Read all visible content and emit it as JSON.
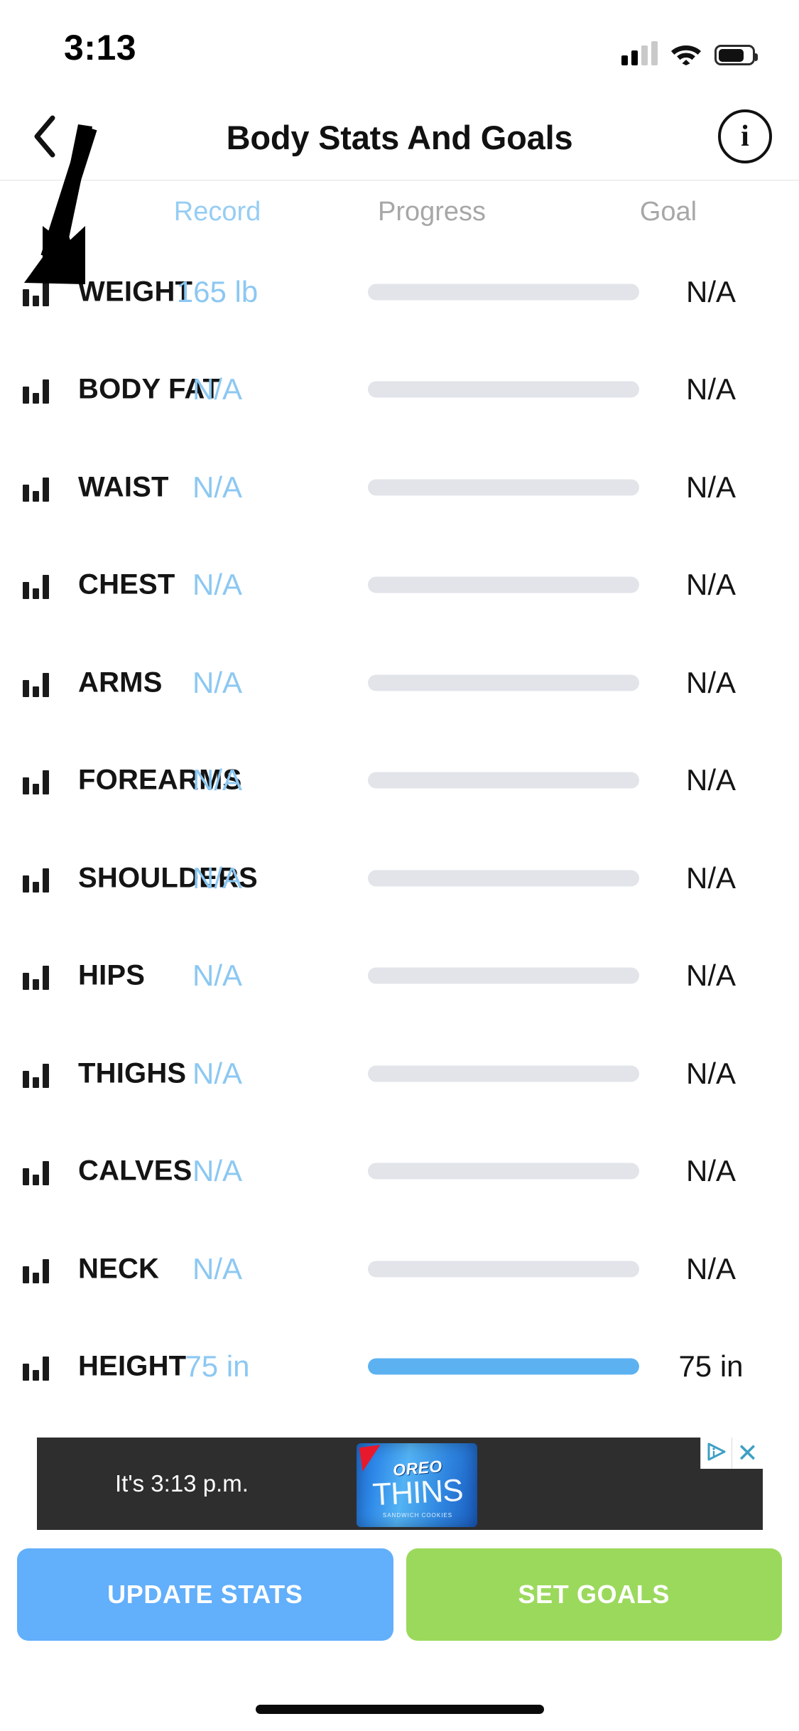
{
  "status_bar": {
    "time": "3:13",
    "signal_icon": "cellular-signal-icon",
    "signal_bars_filled": 2,
    "signal_bars_total": 4,
    "wifi_icon": "wifi-icon",
    "battery_icon": "battery-icon",
    "battery_level_percent": 78
  },
  "nav": {
    "back_icon": "chevron-left-icon",
    "title": "Body Stats And Goals",
    "info_icon": "info-circle-icon",
    "info_label": "i"
  },
  "columns": {
    "record": "Record",
    "progress": "Progress",
    "goal": "Goal"
  },
  "colors": {
    "record_accent": "#8cc8f2",
    "header_record": "#96cdf4",
    "header_muted": "#a7a7a7",
    "progress_track": "#e2e4ea",
    "progress_fill": "#5cb2f0",
    "update_button": "#62AFFB",
    "goals_button": "#9BD95C",
    "ad_background": "#2e2e2e",
    "ad_control_accent": "#3e9fc4"
  },
  "rows": [
    {
      "icon": "bar-chart-icon",
      "name": "WEIGHT",
      "record": "165 lb",
      "goal": "N/A",
      "progress_percent": 0
    },
    {
      "icon": "bar-chart-icon",
      "name": "BODY FAT",
      "record": "N/A",
      "goal": "N/A",
      "progress_percent": 0
    },
    {
      "icon": "bar-chart-icon",
      "name": "WAIST",
      "record": "N/A",
      "goal": "N/A",
      "progress_percent": 0
    },
    {
      "icon": "bar-chart-icon",
      "name": "CHEST",
      "record": "N/A",
      "goal": "N/A",
      "progress_percent": 0
    },
    {
      "icon": "bar-chart-icon",
      "name": "ARMS",
      "record": "N/A",
      "goal": "N/A",
      "progress_percent": 0
    },
    {
      "icon": "bar-chart-icon",
      "name": "FOREARMS",
      "record": "N/A",
      "goal": "N/A",
      "progress_percent": 0
    },
    {
      "icon": "bar-chart-icon",
      "name": "SHOULDERS",
      "record": "N/A",
      "goal": "N/A",
      "progress_percent": 0
    },
    {
      "icon": "bar-chart-icon",
      "name": "HIPS",
      "record": "N/A",
      "goal": "N/A",
      "progress_percent": 0
    },
    {
      "icon": "bar-chart-icon",
      "name": "THIGHS",
      "record": "N/A",
      "goal": "N/A",
      "progress_percent": 0
    },
    {
      "icon": "bar-chart-icon",
      "name": "CALVES",
      "record": "N/A",
      "goal": "N/A",
      "progress_percent": 0
    },
    {
      "icon": "bar-chart-icon",
      "name": "NECK",
      "record": "N/A",
      "goal": "N/A",
      "progress_percent": 0
    },
    {
      "icon": "bar-chart-icon",
      "name": "HEIGHT",
      "record": "75 in",
      "goal": "75 in",
      "progress_percent": 100
    }
  ],
  "ad": {
    "text": "It's 3:13 p.m.",
    "brand": "OREO",
    "product": "THINS",
    "product_sub": "SANDWICH COOKIES",
    "adchoices_icon": "adchoices-triangle-icon",
    "close_icon": "close-x-icon",
    "close_label": "✕"
  },
  "buttons": {
    "update_stats": "UPDATE STATS",
    "set_goals": "SET GOALS"
  },
  "annotation": {
    "pointer_icon": "arrow-pointer-annotation"
  },
  "home_indicator": "home-indicator-bar"
}
